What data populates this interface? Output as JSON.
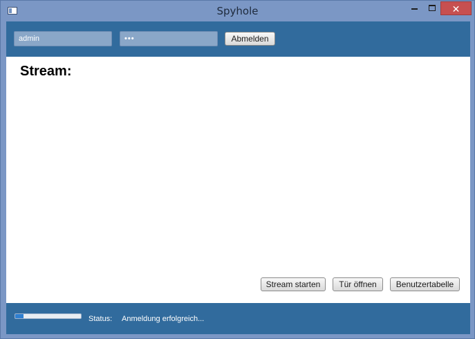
{
  "window": {
    "title": "Spyhole",
    "minimize_icon": "minimize-icon",
    "maximize_icon": "maximize-icon",
    "close_label": "✕"
  },
  "login": {
    "username_value": "admin",
    "password_value": "•••",
    "logout_label": "Abmelden"
  },
  "main": {
    "heading": "Stream:",
    "buttons": {
      "start_stream": "Stream starten",
      "open_door": "Tür öffnen",
      "user_table": "Benutzertabelle"
    }
  },
  "status": {
    "progress_fraction": 0.13,
    "label": "Status:",
    "value": "Anmeldung erfolgreich..."
  },
  "colors": {
    "accent": "#316b9d",
    "window_frame": "#7b97c5",
    "close_button": "#c75050",
    "progress_fill": "#2f7fd0"
  }
}
